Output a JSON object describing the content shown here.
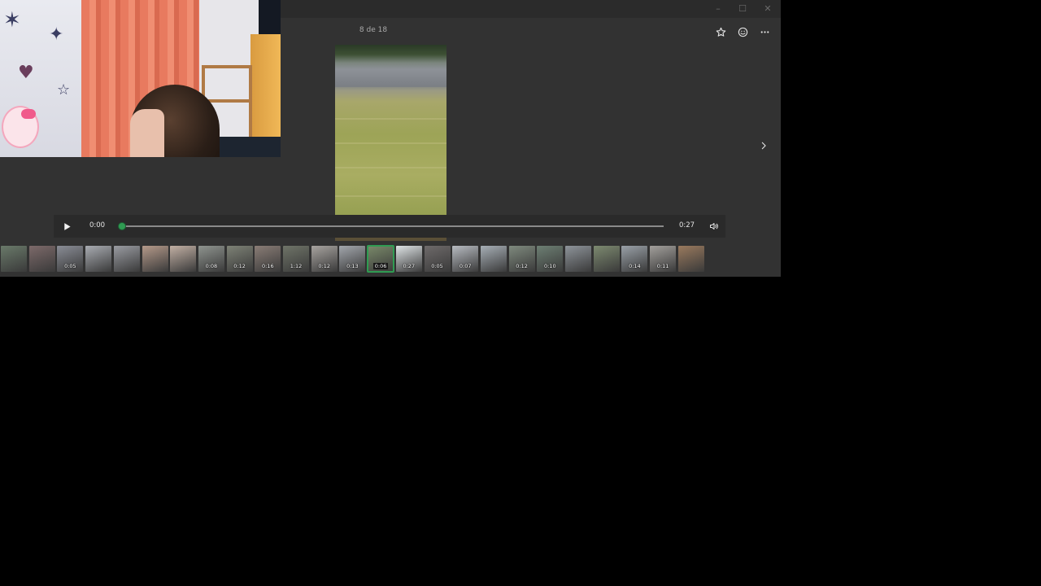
{
  "viewer": {
    "counter": "8 de 18",
    "accent_color": "#2f9b52",
    "window_controls": {
      "minimize": "–",
      "maximize": "☐",
      "close": "✕"
    },
    "icons": [
      "star-icon",
      "emoji-icon",
      "more-icon",
      "chevron-right-icon"
    ]
  },
  "player": {
    "current_time": "0:00",
    "duration": "0:27",
    "progress": 0,
    "icons": [
      "play-icon",
      "volume-icon"
    ]
  },
  "filmstrip": {
    "selected_index": 13,
    "thumbs": [
      {
        "duration": "",
        "color": "#6a7a6a"
      },
      {
        "duration": "",
        "color": "#7d6a6a"
      },
      {
        "duration": "0:05",
        "color": "#8a8d96"
      },
      {
        "duration": "",
        "color": "#a9acb2"
      },
      {
        "duration": "",
        "color": "#9a9ca2"
      },
      {
        "duration": "",
        "color": "#b59a8a"
      },
      {
        "duration": "",
        "color": "#c2b0a4"
      },
      {
        "duration": "0:08",
        "color": "#8f948f"
      },
      {
        "duration": "0:12",
        "color": "#7e8276"
      },
      {
        "duration": "0:16",
        "color": "#8a7d76"
      },
      {
        "duration": "1:12",
        "color": "#6f7468"
      },
      {
        "duration": "0:12",
        "color": "#a8a4a0"
      },
      {
        "duration": "0:13",
        "color": "#a3a7ad"
      },
      {
        "duration": "0:06",
        "color": "#7a8a6a"
      },
      {
        "duration": "0:27",
        "color": "#dfe4e6"
      },
      {
        "duration": "0:05",
        "color": "#6e6a6a"
      },
      {
        "duration": "0:07",
        "color": "#b8bcc2"
      },
      {
        "duration": "",
        "color": "#a7afb6"
      },
      {
        "duration": "0:12",
        "color": "#7f8a7e"
      },
      {
        "duration": "0:10",
        "color": "#6d7f73"
      },
      {
        "duration": "",
        "color": "#8e949a"
      },
      {
        "duration": "",
        "color": "#7d8a70"
      },
      {
        "duration": "0:14",
        "color": "#9aa1a8"
      },
      {
        "duration": "0:11",
        "color": "#a3a09c"
      },
      {
        "duration": "",
        "color": "#9a7a5e"
      }
    ]
  }
}
